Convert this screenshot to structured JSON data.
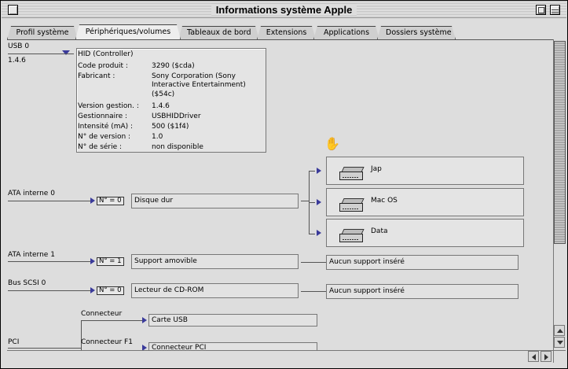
{
  "window": {
    "title": "Informations système Apple"
  },
  "tabs": [
    {
      "label": "Profil système"
    },
    {
      "label": "Périphériques/volumes"
    },
    {
      "label": "Tableaux de bord"
    },
    {
      "label": "Extensions"
    },
    {
      "label": "Applications"
    },
    {
      "label": "Dossiers système"
    }
  ],
  "usb": {
    "bus_label": "USB 0",
    "version": "1.4.6",
    "device_title": "HID (Controller)",
    "details": [
      {
        "key": "Code produit :",
        "value": "3290 ($cda)"
      },
      {
        "key": "Fabricant :",
        "value": "Sony Corporation (Sony"
      },
      {
        "key": "",
        "value": "Interactive Entertainment)"
      },
      {
        "key": "",
        "value": "($54c)"
      },
      {
        "key": "Version gestion. :",
        "value": "1.4.6"
      },
      {
        "key": "Gestionnaire :",
        "value": "USBHIDDriver"
      },
      {
        "key": "Intensité (mA) :",
        "value": "500 ($1f4)"
      },
      {
        "key": "N° de version :",
        "value": "1.0"
      },
      {
        "key": "N° de série :",
        "value": "non disponible"
      }
    ]
  },
  "ata0": {
    "bus_label": "ATA interne 0",
    "num": "N° = 0",
    "device": "Disque dur",
    "volumes": [
      "Jap",
      "Mac OS",
      "Data"
    ]
  },
  "ata1": {
    "bus_label": "ATA interne 1",
    "num": "N° = 1",
    "device": "Support amovible",
    "media": "Aucun support inséré"
  },
  "scsi": {
    "bus_label": "Bus SCSI 0",
    "num": "N° = 0",
    "device": "Lecteur de CD-ROM",
    "media": "Aucun support inséré"
  },
  "pci": {
    "bus_label": "PCI",
    "connector1": "Connecteur",
    "card1": "Carte USB",
    "connector2": "Connecteur F1",
    "card2": "Connecteur PCI"
  },
  "colors": {
    "triangle": "#3a3a9a",
    "window_bg": "#dddddd"
  }
}
